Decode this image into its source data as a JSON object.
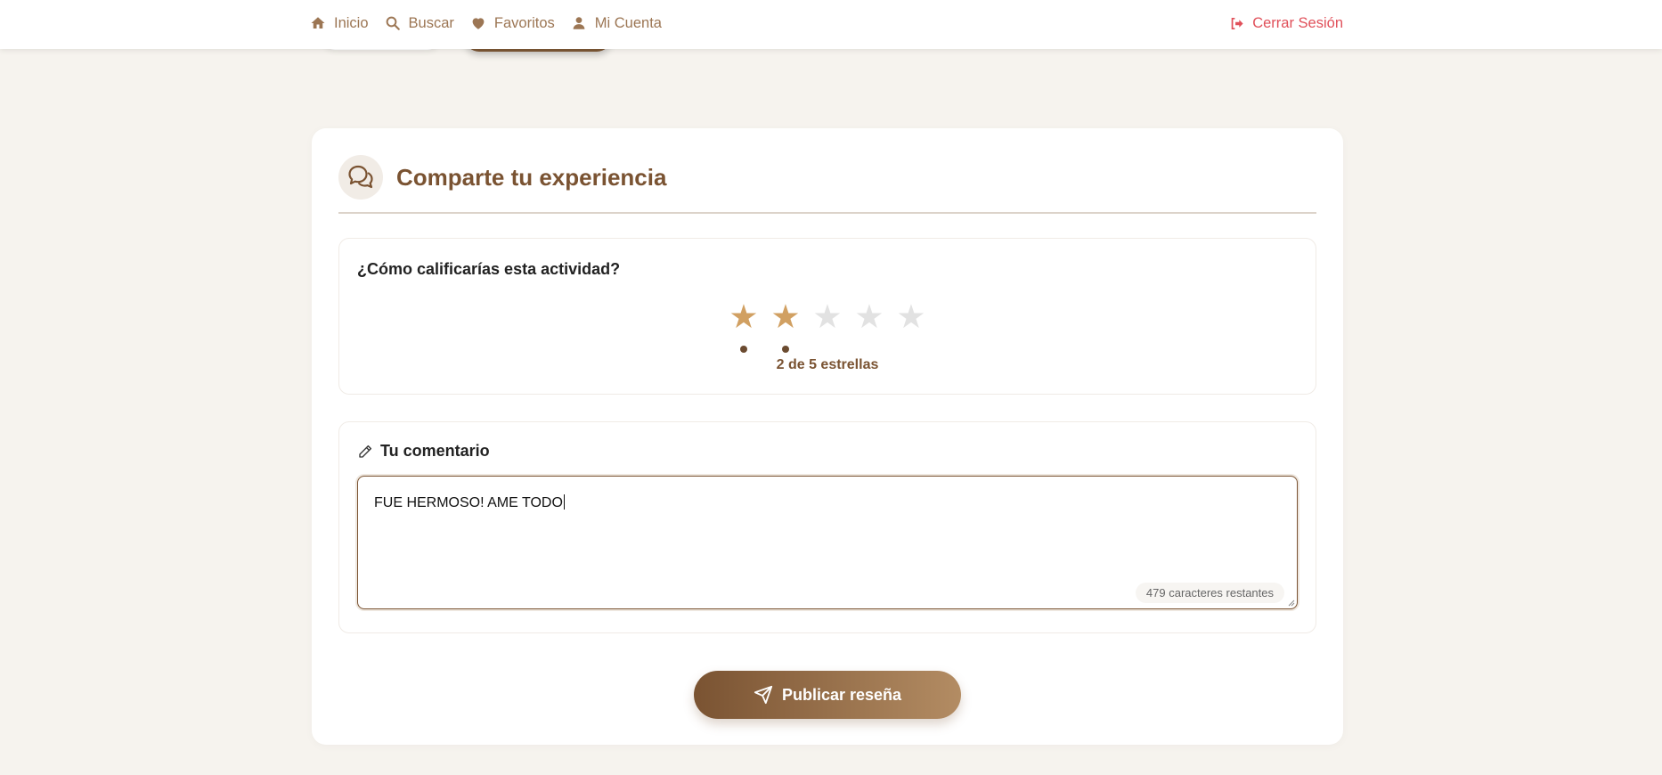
{
  "nav": {
    "items": [
      {
        "label": "Inicio",
        "icon": "home-icon"
      },
      {
        "label": "Buscar",
        "icon": "search-icon"
      },
      {
        "label": "Favoritos",
        "icon": "heart-icon"
      },
      {
        "label": "Mi Cuenta",
        "icon": "user-icon"
      }
    ],
    "logout": {
      "label": "Cerrar Sesión",
      "icon": "logout-icon"
    }
  },
  "review": {
    "title": "Comparte tu experiencia",
    "rating": {
      "question": "¿Cómo calificarías esta actividad?",
      "value": 2,
      "max": 5,
      "star_glyph": "★",
      "label": "2 de 5 estrellas"
    },
    "comment": {
      "label": "Tu comentario",
      "value": "FUE HERMOSO! AME TODO",
      "counter": "479 caracteres restantes"
    },
    "submit_label": "Publicar reseña"
  },
  "colors": {
    "brand": "#7a5332",
    "star_on": "#d1a062",
    "star_off": "#e2e2e2",
    "logout": "#e0505a",
    "background": "#f6f3ee"
  }
}
